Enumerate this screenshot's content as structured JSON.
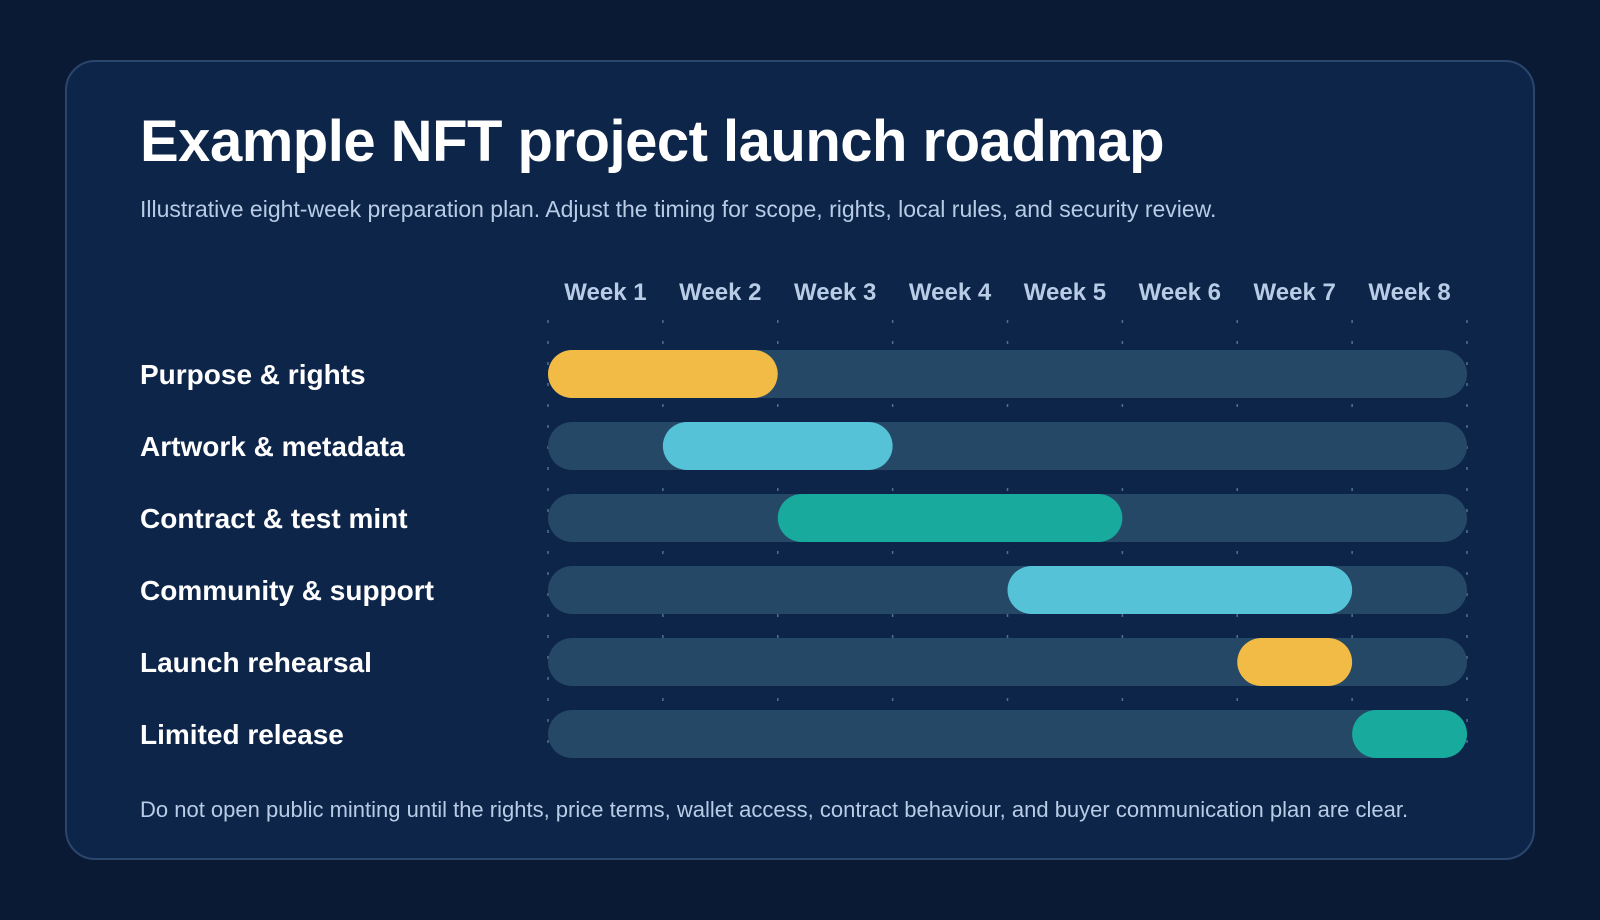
{
  "title": "Example NFT project launch roadmap",
  "subtitle": "Illustrative eight-week preparation plan. Adjust the timing for scope, rights, local rules, and security review.",
  "footnote": "Do not open public minting until the rights, price terms, wallet access, contract behaviour, and buyer communication plan are clear.",
  "colors": {
    "background": "#0a1a34",
    "card": "#0d2549",
    "track": "#264867",
    "amber": "#f2bb45",
    "sky": "#56c2d8",
    "teal": "#17aa9d",
    "muted_text": "#b8cce6"
  },
  "chart_data": {
    "type": "gantt",
    "categories": [
      "Week 1",
      "Week 2",
      "Week 3",
      "Week 4",
      "Week 5",
      "Week 6",
      "Week 7",
      "Week 8"
    ],
    "tasks": [
      {
        "name": "Purpose & rights",
        "start_week": 1,
        "end_week": 2,
        "color": "#f2bb45"
      },
      {
        "name": "Artwork & metadata",
        "start_week": 2,
        "end_week": 3,
        "color": "#56c2d8"
      },
      {
        "name": "Contract & test mint",
        "start_week": 3,
        "end_week": 5,
        "color": "#17aa9d"
      },
      {
        "name": "Community & support",
        "start_week": 5,
        "end_week": 7,
        "color": "#56c2d8"
      },
      {
        "name": "Launch rehearsal",
        "start_week": 7,
        "end_week": 7,
        "color": "#f2bb45"
      },
      {
        "name": "Limited release",
        "start_week": 8,
        "end_week": 8,
        "color": "#17aa9d"
      }
    ],
    "xlim": [
      1,
      8
    ],
    "grid": true
  }
}
